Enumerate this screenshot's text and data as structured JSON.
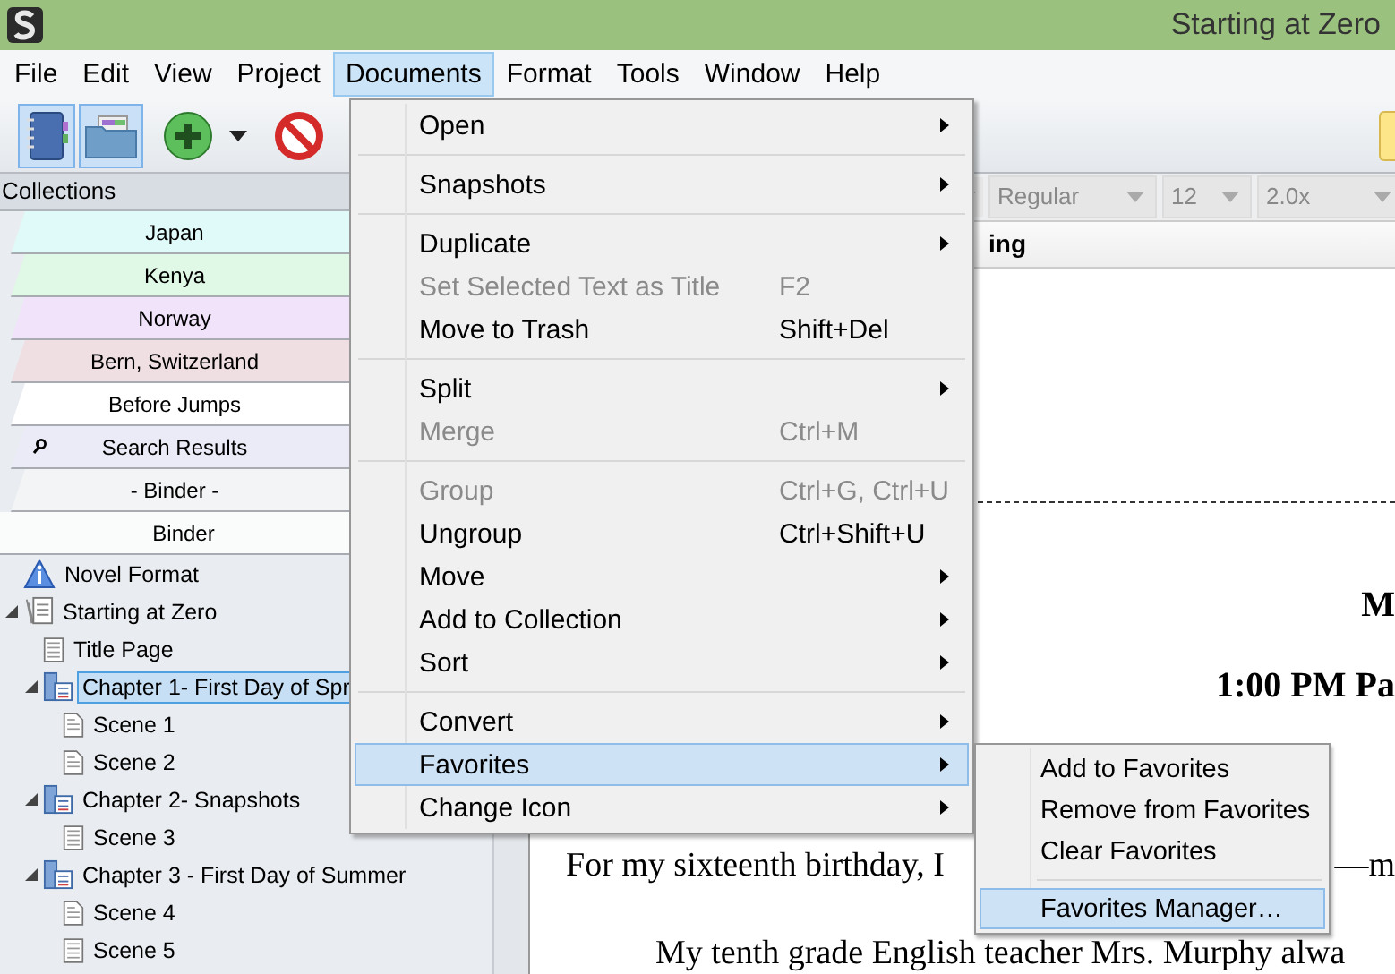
{
  "window": {
    "title": "Starting at Zero"
  },
  "menubar": [
    {
      "label": "File",
      "selected": false
    },
    {
      "label": "Edit",
      "selected": false
    },
    {
      "label": "View",
      "selected": false
    },
    {
      "label": "Project",
      "selected": false
    },
    {
      "label": "Documents",
      "selected": true
    },
    {
      "label": "Format",
      "selected": false
    },
    {
      "label": "Tools",
      "selected": false
    },
    {
      "label": "Window",
      "selected": false
    },
    {
      "label": "Help",
      "selected": false
    }
  ],
  "toolbar": [
    {
      "kind": "binder",
      "pressed": true
    },
    {
      "kind": "collections",
      "pressed": true
    },
    {
      "kind": "add",
      "pressed": false
    },
    {
      "kind": "caret",
      "pressed": false
    },
    {
      "kind": "delete",
      "pressed": false
    }
  ],
  "collections": {
    "title": "Collections",
    "tabs": [
      {
        "label": "Japan",
        "kind": "collection",
        "color": "#dffaf8"
      },
      {
        "label": "Kenya",
        "kind": "collection",
        "color": "#e0f8e6"
      },
      {
        "label": "Norway",
        "kind": "collection",
        "color": "#f1e4fa"
      },
      {
        "label": "Bern, Switzerland",
        "kind": "collection",
        "color": "#efdfe3"
      },
      {
        "label": "Before Jumps",
        "kind": "collection",
        "color": "#ffffff"
      },
      {
        "label": "Search Results",
        "kind": "search",
        "color": "#ebebf7"
      },
      {
        "label": "- Binder -",
        "kind": "collection",
        "color": "#f2f4f5"
      },
      {
        "label": "Binder",
        "kind": "binder",
        "color": "#fafbfb"
      }
    ]
  },
  "binder": [
    {
      "label": "Novel Format",
      "kind": "info",
      "selected": false
    },
    {
      "label": "Starting at Zero",
      "kind": "project",
      "selected": false,
      "expanded": true,
      "children": [
        {
          "label": "Title Page",
          "kind": "page",
          "selected": false
        },
        {
          "label": "Chapter 1- First Day of Spr",
          "kind": "folder",
          "selected": true,
          "expanded": true,
          "children": [
            {
              "label": "Scene 1",
              "kind": "text",
              "selected": false
            },
            {
              "label": "Scene 2",
              "kind": "text",
              "selected": false
            }
          ]
        },
        {
          "label": "Chapter 2- Snapshots",
          "kind": "folder",
          "selected": false,
          "expanded": true,
          "children": [
            {
              "label": "Scene 3",
              "kind": "page",
              "selected": false
            }
          ]
        },
        {
          "label": "Chapter 3 - First Day of Summer",
          "kind": "folder",
          "selected": false,
          "expanded": true,
          "children": [
            {
              "label": "Scene 4",
              "kind": "text",
              "selected": false
            },
            {
              "label": "Scene 5",
              "kind": "page",
              "selected": false
            }
          ]
        }
      ]
    }
  ],
  "format_bar": [
    {
      "value": "Regular"
    },
    {
      "value": "12"
    },
    {
      "value": "2.0x"
    }
  ],
  "editor": {
    "header": "ing",
    "lines": [
      {
        "kind": "heading",
        "text": "M"
      },
      {
        "kind": "heading",
        "text": "1:00 PM Pa"
      },
      {
        "kind": "split",
        "texts": [
          "For my sixteenth birthday, I",
          "—m"
        ]
      },
      {
        "kind": "paragraph",
        "text": "My tenth grade English teacher Mrs. Murphy alwa"
      }
    ]
  },
  "documents_menu": [
    [
      {
        "label": "Open",
        "submenu": true,
        "disabled": false,
        "selected": false
      }
    ],
    [
      {
        "label": "Snapshots",
        "submenu": true,
        "disabled": false,
        "selected": false
      }
    ],
    [
      {
        "label": "Duplicate",
        "submenu": true,
        "disabled": false,
        "selected": false
      },
      {
        "label": "Set Selected Text as Title",
        "shortcut": "F2",
        "disabled": true,
        "selected": false
      },
      {
        "label": "Move to Trash",
        "shortcut": "Shift+Del",
        "disabled": false,
        "selected": false
      }
    ],
    [
      {
        "label": "Split",
        "submenu": true,
        "disabled": false,
        "selected": false
      },
      {
        "label": "Merge",
        "shortcut": "Ctrl+M",
        "disabled": true,
        "selected": false
      }
    ],
    [
      {
        "label": "Group",
        "shortcut": "Ctrl+G, Ctrl+U",
        "disabled": true,
        "selected": false
      },
      {
        "label": "Ungroup",
        "shortcut": "Ctrl+Shift+U",
        "disabled": false,
        "selected": false
      },
      {
        "label": "Move",
        "submenu": true,
        "disabled": false,
        "selected": false
      },
      {
        "label": "Add to Collection",
        "submenu": true,
        "disabled": false,
        "selected": false
      },
      {
        "label": "Sort",
        "submenu": true,
        "disabled": false,
        "selected": false
      }
    ],
    [
      {
        "label": "Convert",
        "submenu": true,
        "disabled": false,
        "selected": false
      },
      {
        "label": "Favorites",
        "submenu": true,
        "disabled": false,
        "selected": true
      },
      {
        "label": "Change Icon",
        "submenu": true,
        "disabled": false,
        "selected": false
      }
    ]
  ],
  "favorites_submenu": [
    [
      {
        "label": "Add to Favorites",
        "selected": false
      },
      {
        "label": "Remove from Favorites",
        "selected": false
      },
      {
        "label": "Clear Favorites",
        "selected": false
      }
    ],
    [
      {
        "label": "Favorites Manager…",
        "selected": true
      }
    ]
  ]
}
